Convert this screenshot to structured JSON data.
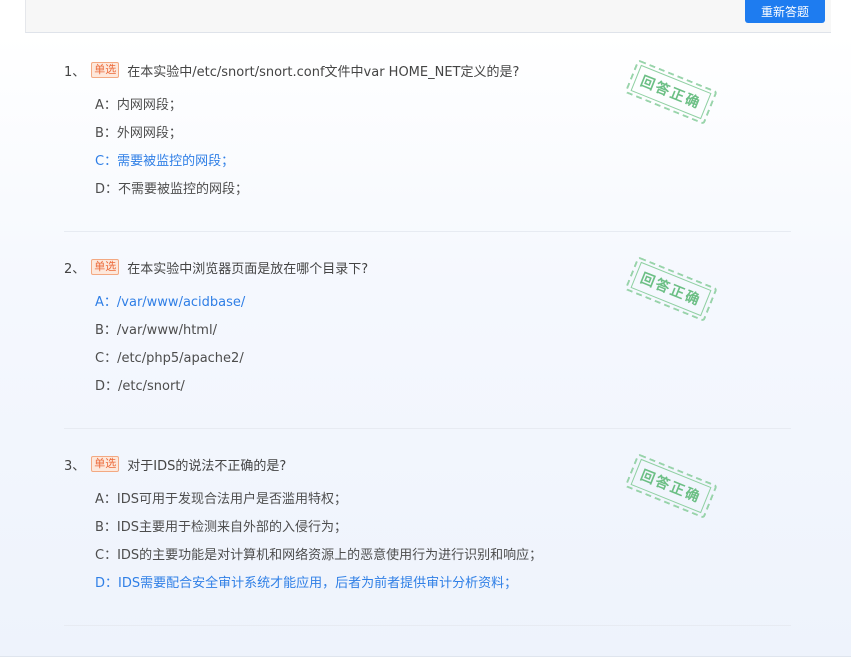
{
  "toolbar": {
    "redo_label": "重新答题"
  },
  "questions": [
    {
      "number": "1、",
      "tag": "单选",
      "text": "在本实验中/etc/snort/snort.conf文件中var HOME_NET定义的是?",
      "stamp": "回答正确",
      "options": [
        {
          "letter": "A：",
          "text": "内网网段；"
        },
        {
          "letter": "B：",
          "text": "外网网段；"
        },
        {
          "letter": "C：",
          "text": "需要被监控的网段；"
        },
        {
          "letter": "D：",
          "text": "不需要被监控的网段；"
        }
      ],
      "correct_option": "C"
    },
    {
      "number": "2、",
      "tag": "单选",
      "text": "在本实验中浏览器页面是放在哪个目录下?",
      "stamp": "回答正确",
      "options": [
        {
          "letter": "A：",
          "text": "/var/www/acidbase/"
        },
        {
          "letter": "B：",
          "text": "/var/www/html/"
        },
        {
          "letter": "C：",
          "text": "/etc/php5/apache2/"
        },
        {
          "letter": "D：",
          "text": "/etc/snort/"
        }
      ],
      "correct_option": "A"
    },
    {
      "number": "3、",
      "tag": "单选",
      "text": "对于IDS的说法不正确的是?",
      "stamp": "回答正确",
      "options": [
        {
          "letter": "A：",
          "text": "IDS可用于发现合法用户是否滥用特权；"
        },
        {
          "letter": "B：",
          "text": "IDS主要用于检测来自外部的入侵行为；"
        },
        {
          "letter": "C：",
          "text": "IDS的主要功能是对计算机和网络资源上的恶意使用行为进行识别和响应；"
        },
        {
          "letter": "D：",
          "text": "IDS需要配合安全审计系统才能应用，后者为前者提供审计分析资料；"
        }
      ],
      "correct_option": "D"
    }
  ],
  "colors": {
    "accent": "#1e7cf0",
    "correct_text": "#2f7fe6",
    "tag": "#ec6a3a",
    "stamp": "#6cbf85"
  }
}
